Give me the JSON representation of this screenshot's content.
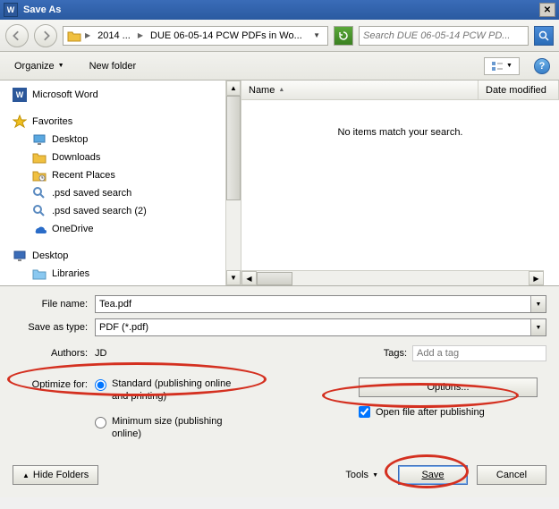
{
  "titlebar": {
    "title": "Save As"
  },
  "navbar": {
    "crumb1": "2014 ...",
    "crumb2": "DUE 06-05-14 PCW PDFs in Wo...",
    "search_placeholder": "Search DUE 06-05-14 PCW PD..."
  },
  "toolbar": {
    "organize": "Organize",
    "newfolder": "New folder"
  },
  "sidebar": {
    "items": [
      {
        "label": "Microsoft Word",
        "icon": "word"
      },
      {
        "label": "Favorites",
        "icon": "star",
        "top": true
      },
      {
        "label": "Desktop",
        "icon": "desktop",
        "indent": true
      },
      {
        "label": "Downloads",
        "icon": "folder",
        "indent": true
      },
      {
        "label": "Recent Places",
        "icon": "recent",
        "indent": true
      },
      {
        "label": ".psd saved search",
        "icon": "search-file",
        "indent": true
      },
      {
        "label": ".psd saved search (2)",
        "icon": "search-file",
        "indent": true
      },
      {
        "label": "OneDrive",
        "icon": "onedrive",
        "indent": true
      },
      {
        "label": "Desktop",
        "icon": "desktop-blue",
        "top": true
      },
      {
        "label": "Libraries",
        "icon": "libraries",
        "indent": true
      }
    ]
  },
  "filelist": {
    "col_name": "Name",
    "col_date": "Date modified",
    "empty_msg": "No items match your search."
  },
  "form": {
    "filename_label": "File name:",
    "filename_value": "Tea.pdf",
    "type_label": "Save as type:",
    "type_value": "PDF (*.pdf)",
    "authors_label": "Authors:",
    "authors_value": "JD",
    "tags_label": "Tags:",
    "tags_placeholder": "Add a tag",
    "optimize_label": "Optimize for:",
    "radio_standard": "Standard (publishing online and printing)",
    "radio_min": "Minimum size (publishing online)",
    "options_btn": "Options...",
    "open_after": "Open file after publishing"
  },
  "footer": {
    "hide": "Hide Folders",
    "tools": "Tools",
    "save": "Save",
    "cancel": "Cancel"
  }
}
